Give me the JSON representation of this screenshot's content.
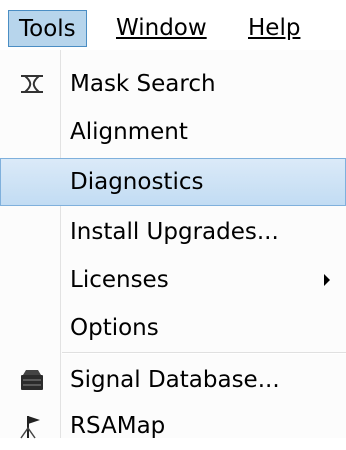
{
  "menubar": {
    "tools": "Tools",
    "window": "Window",
    "help": "Help"
  },
  "menu": {
    "items": [
      {
        "label": "Mask Search",
        "icon": "mask-search-icon"
      },
      {
        "label": "Alignment"
      },
      {
        "label": "Diagnostics",
        "highlighted": true
      },
      {
        "label": "Install Upgrades..."
      },
      {
        "label": "Licenses",
        "has_submenu": true
      },
      {
        "label": "Options"
      },
      {
        "label": "Signal Database...",
        "icon": "database-icon"
      },
      {
        "label": "RSAMap",
        "icon": "map-flag-icon"
      }
    ]
  },
  "colors": {
    "active_menu_bg": "#b7d5ec",
    "highlight_bg": "#c2dcf3"
  }
}
